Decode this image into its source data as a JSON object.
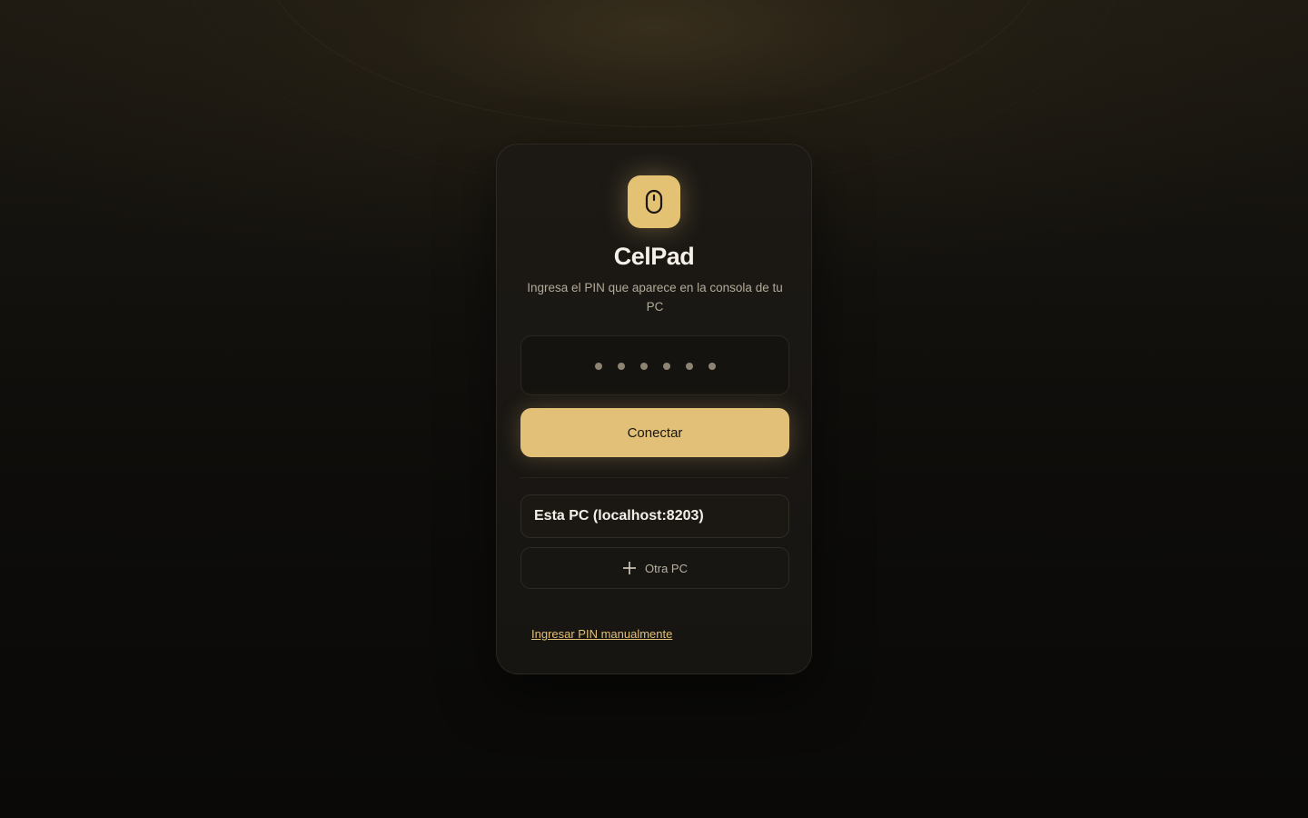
{
  "app": {
    "title": "CelPad",
    "subtitle": "Ingresa el PIN que aparece en la consola de tu PC",
    "logo_icon": "mouse-icon"
  },
  "pin": {
    "length": 6,
    "value": ""
  },
  "actions": {
    "connect_label": "Conectar",
    "other_pc_label": "Otra PC",
    "manual_pin_label": "Ingresar PIN manualmente"
  },
  "pcs": [
    {
      "label": "Esta PC (localhost:8203)"
    }
  ],
  "colors": {
    "accent": "#e2c077",
    "background": "#0c0b09",
    "card": "#1c1915",
    "text": "#f4f0e8",
    "muted": "#b3aa98"
  }
}
